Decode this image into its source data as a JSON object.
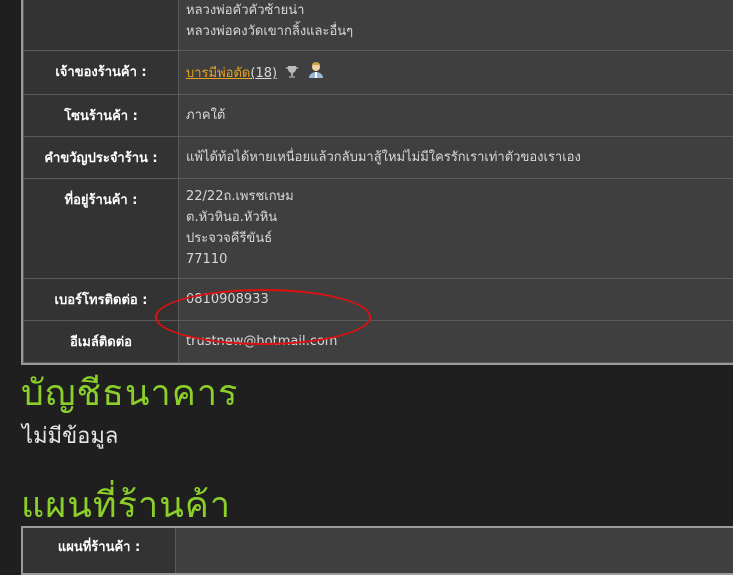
{
  "shop_info": {
    "top_lines": [
      "หลวงพ่อคัวคัวซ้ายน่า",
      "หลวงพ่อคงวัดเขากลิ้งและอื่นๆ"
    ],
    "owner_label": "เจ้าของร้านค้า :",
    "owner_name": "บารมีพ่อตัด",
    "owner_count": "(18)",
    "owner_icons": [
      "trophy-icon",
      "user-avatar-icon"
    ],
    "zone_label": "โซนร้านค้า :",
    "zone_value": "ภาคใต้",
    "slogan_label": "คำขวัญประจำร้าน :",
    "slogan_value": "แพ้ได้ท้อได้หายเหนื่อยแล้วกลับมาสู้ใหม่ไม่มีใครรักเราเท่าตัวของเราเอง",
    "address_label": "ที่อยู่ร้านค้า :",
    "address_lines": [
      "22/22ถ.เพรชเกษม",
      "ต.หัวหินอ.หัวหิน",
      "ประจวจคีรีขันธ์",
      "77110"
    ],
    "phone_label": "เบอร์โทรติดต่อ :",
    "phone_value": "0810908933",
    "email_label": "อีเมล์ติดต่อ",
    "email_value": "trustnew@hotmail.com"
  },
  "bank": {
    "heading": "บัญชีธนาคาร",
    "empty_text": "ไม่มีข้อมูล"
  },
  "map": {
    "heading": "แผนที่ร้านค้า",
    "label": "แผนที่ร้านค้า :"
  },
  "colors": {
    "heading_green": "#8ccf2a",
    "link_orange": "#e8a020",
    "highlight_red": "#d11111"
  }
}
